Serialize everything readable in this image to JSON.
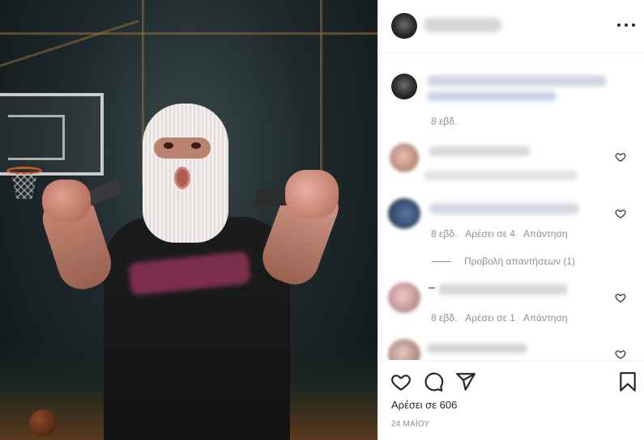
{
  "post": {
    "likes_text": "Αρέσει σε 606",
    "date_text": "24 ΜΑΪΟΥ"
  },
  "caption": {
    "time": "8 εβδ."
  },
  "comments": [
    {
      "time": "",
      "likes": "",
      "reply": ""
    },
    {
      "time": "8 εβδ.",
      "likes": "Αρέσει σε 4",
      "reply": "Απάντηση"
    },
    {
      "time": "8 εβδ.",
      "likes": "Αρέσει σε 1",
      "reply": "Απάντηση"
    },
    {
      "time": "",
      "likes": "",
      "reply": ""
    }
  ],
  "view_replies": "Προβολή απαντήσεων (1)",
  "icons": {
    "more": "more-options-icon",
    "like": "heart-icon",
    "comment": "comment-icon",
    "share": "share-icon",
    "save": "bookmark-icon"
  },
  "colors": {
    "text": "#262626",
    "secondary": "#8e8e8e",
    "divider": "#efefef"
  }
}
